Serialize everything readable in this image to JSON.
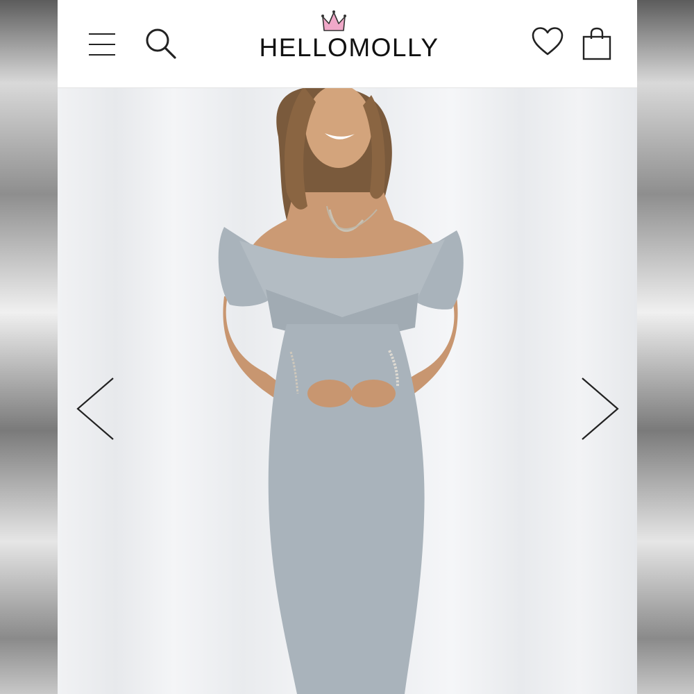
{
  "brand": {
    "name": "HELLOMOLLY",
    "crown_color": "#f0a8c8"
  },
  "header": {
    "icons": [
      "menu-icon",
      "search-icon",
      "heart-icon",
      "shopping-bag-icon"
    ]
  },
  "gallery": {
    "navigation": [
      "previous-arrow",
      "next-arrow"
    ],
    "image": {
      "subject": "product-photo",
      "dress_color": "#a9b3bb",
      "backdrop_color": "#eef0f2"
    }
  }
}
